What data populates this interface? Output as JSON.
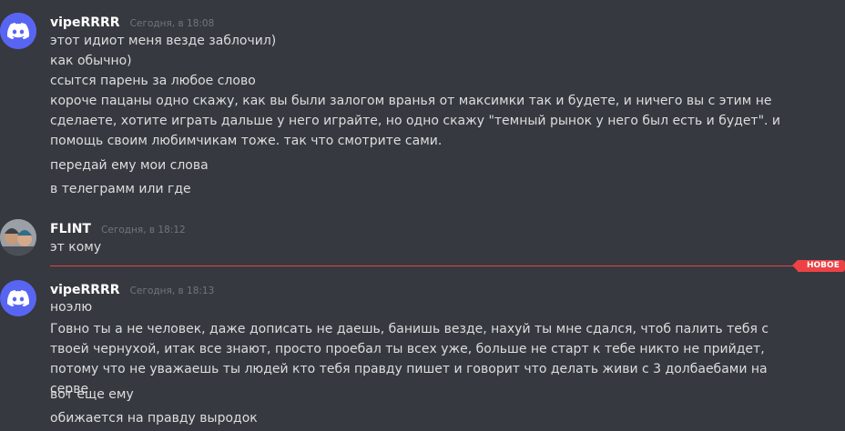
{
  "messages": [
    {
      "username": "vipeRRRR",
      "timestamp": "Сегодня, в 18:08",
      "lines": [
        "этот идиот меня везде заблочил)",
        "как обычно)",
        "ссытся парень за любое слово",
        "короче  пацаны одно скажу, как вы были залогом вранья от максимки так и будете, и ничего вы с этим не сделаете, хотите играть дальше у него играйте, но одно скажу \"темный рынок у него был есть и будет\". и помощь своим любимчикам тоже. так что смотрите сами.",
        "передай ему мои слова",
        "в телеграмм или где"
      ]
    },
    {
      "username": "FLINT",
      "timestamp": "Сегодня, в 18:12",
      "lines": [
        "эт кому"
      ]
    },
    {
      "username": "vipeRRRR",
      "timestamp": "Сегодня, в 18:13",
      "lines": [
        "ноэлю",
        "Говно ты  а не человек, даже дописать не даешь, банишь везде,  нахуй ты мне сдался, чтоб палить тебя с твоей чернухой, итак все знают, просто проебал ты всех уже, больше не старт к тебе никто не прийдет, потому что не уважаешь ты людей кто тебя правду пишет и говорит что делать живи с 3 долбаебами на серве",
        "вот еще ему",
        "обижается на правду выродок"
      ]
    }
  ],
  "divider": {
    "label": "НОВОЕ",
    "color": "#ed4245"
  },
  "colors": {
    "background": "#36393f",
    "discord_blurple": "#5865f2",
    "text": "#dcddde",
    "username": "#ffffff",
    "timestamp": "#72767d"
  },
  "icons": {
    "discord_avatar": "discord-logo-icon",
    "flint_avatar": "user-photo-avatar"
  }
}
